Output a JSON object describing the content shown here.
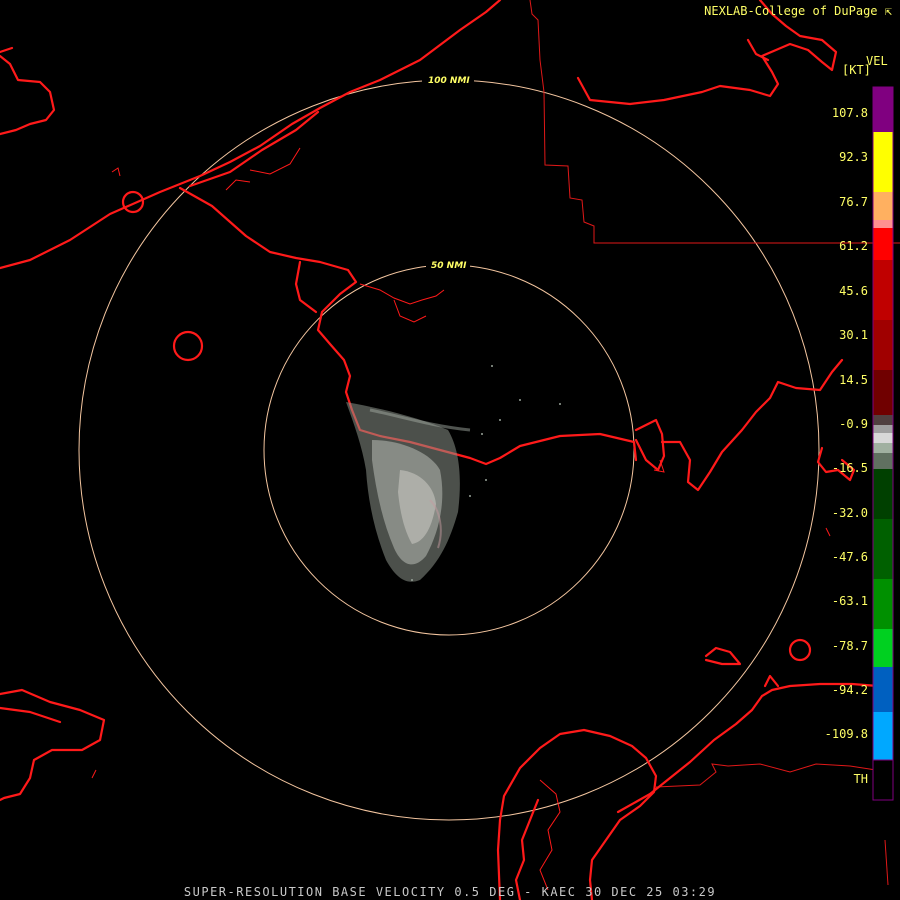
{
  "credit": "NEXLAB-College of DuPage",
  "legend": {
    "product": "VEL",
    "unit": "[KT]",
    "labels": [
      "107.8",
      "92.3",
      "76.7",
      "61.2",
      "45.6",
      "30.1",
      "14.5",
      "-0.9",
      "-16.5",
      "-32.0",
      "-47.6",
      "-63.1",
      "-78.7",
      "-94.2",
      "-109.8",
      "TH"
    ]
  },
  "range_rings": {
    "inner": "50 NMI",
    "outer": "100 NMI"
  },
  "footer": "SUPER-RESOLUTION BASE VELOCITY 0.5 DEG - KAEC 30 DEC 25 03:29",
  "colors": {
    "coast": "#ff1a1a",
    "border": "#e01818",
    "ring": "#f4c6a0",
    "text": "#ffff66"
  }
}
